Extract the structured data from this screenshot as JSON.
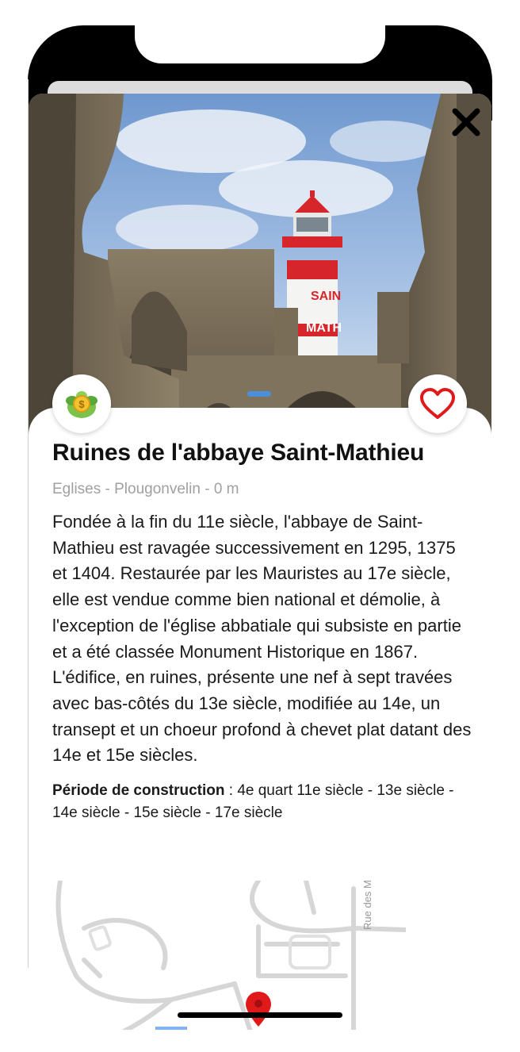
{
  "place": {
    "title": "Ruines de l'abbaye Saint-Mathieu",
    "subtitle": "Eglises - Plougonvelin - 0 m",
    "description": "Fondée à la fin du 11e siècle, l'abbaye de Saint-Mathieu est ravagée successivement en 1295, 1375 et 1404. Restaurée par les Mauristes au 17e siècle, elle est vendue comme bien national et démolie, à l'exception de l'église abbatiale qui subsiste en partie et a été classée Monument Historique en 1867. L'édifice, en ruines, présente une nef à sept travées avec bas-côtés du 13e siècle, modifiée au 14e, un transept et un choeur profond à chevet plat datant des 14e et 15e siècles.",
    "period_label": "Période de construction",
    "period_value": " : 4e quart 11e siècle - 13e siècle - 14e siècle - 15e siècle - 17e siècle"
  },
  "hero": {
    "lighthouse_text_1": "SAIN",
    "lighthouse_text_2": "MATH"
  },
  "map": {
    "street_label": "Rue des Moines"
  },
  "icons": {
    "close": "close-icon",
    "category": "money-plant-icon",
    "favorite": "heart-outline-icon",
    "map_pin": "map-pin-icon"
  },
  "colors": {
    "favorite_accent": "#e0191b",
    "carousel_active": "#4a90d9",
    "pin": "#e0191b",
    "subtitle": "#a0a0a0"
  }
}
